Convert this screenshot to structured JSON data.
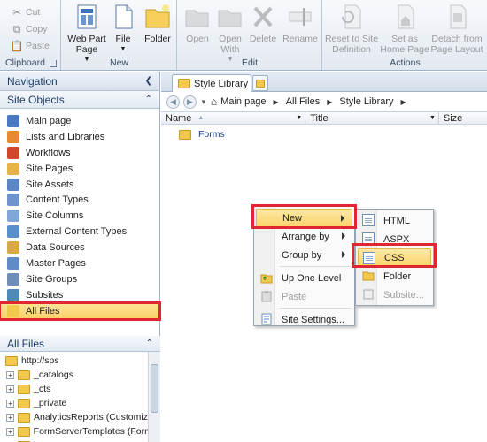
{
  "ribbon": {
    "clipboard": {
      "label": "Clipboard",
      "cut": "Cut",
      "copy": "Copy",
      "paste": "Paste"
    },
    "new": {
      "label": "New",
      "web_part_page": "Web Part Page",
      "file": "File",
      "folder": "Folder"
    },
    "edit": {
      "label": "Edit",
      "open": "Open",
      "open_with": "Open With",
      "delete": "Delete",
      "rename": "Rename"
    },
    "actions": {
      "label": "Actions",
      "reset_to_site_definition": "Reset to Site Definition",
      "set_as_home_page": "Set as Home Page",
      "detach_from_page_layout": "Detach from Page Layout"
    }
  },
  "navigation": {
    "title": "Navigation",
    "site_objects_title": "Site Objects",
    "items": [
      {
        "label": "Main page",
        "color": "#4a78c2"
      },
      {
        "label": "Lists and Libraries",
        "color": "#e58a2e"
      },
      {
        "label": "Workflows",
        "color": "#d2462e"
      },
      {
        "label": "Site Pages",
        "color": "#e8b24a"
      },
      {
        "label": "Site Assets",
        "color": "#5a86c5"
      },
      {
        "label": "Content Types",
        "color": "#6d94cc"
      },
      {
        "label": "Site Columns",
        "color": "#7fa6d6"
      },
      {
        "label": "External Content Types",
        "color": "#5b8fc9"
      },
      {
        "label": "Data Sources",
        "color": "#d9a84a"
      },
      {
        "label": "Master Pages",
        "color": "#5f8bc7"
      },
      {
        "label": "Site Groups",
        "color": "#6e8eb8"
      },
      {
        "label": "Subsites",
        "color": "#4f8ab7"
      },
      {
        "label": "All Files",
        "color": "#f2c94c"
      }
    ],
    "all_files_title": "All Files",
    "tree": {
      "root": "http://sps",
      "items": [
        "_catalogs",
        "_cts",
        "_private",
        "AnalyticsReports (Customized",
        "FormServerTemplates (Form T",
        "images"
      ]
    }
  },
  "main": {
    "tab_label": "Style Library",
    "breadcrumb": [
      "Main page",
      "All Files",
      "Style Library"
    ],
    "columns": {
      "name": "Name",
      "title": "Title",
      "size": "Size"
    },
    "files": [
      "Forms"
    ]
  },
  "context_menu": {
    "items": [
      {
        "label": "New"
      },
      {
        "label": "Arrange by"
      },
      {
        "label": "Group by"
      },
      {
        "label": "Up One Level"
      },
      {
        "label": "Paste"
      },
      {
        "label": "Site Settings..."
      }
    ]
  },
  "submenu": {
    "items": [
      "HTML",
      "ASPX",
      "CSS",
      "Folder",
      "Subsite..."
    ]
  }
}
